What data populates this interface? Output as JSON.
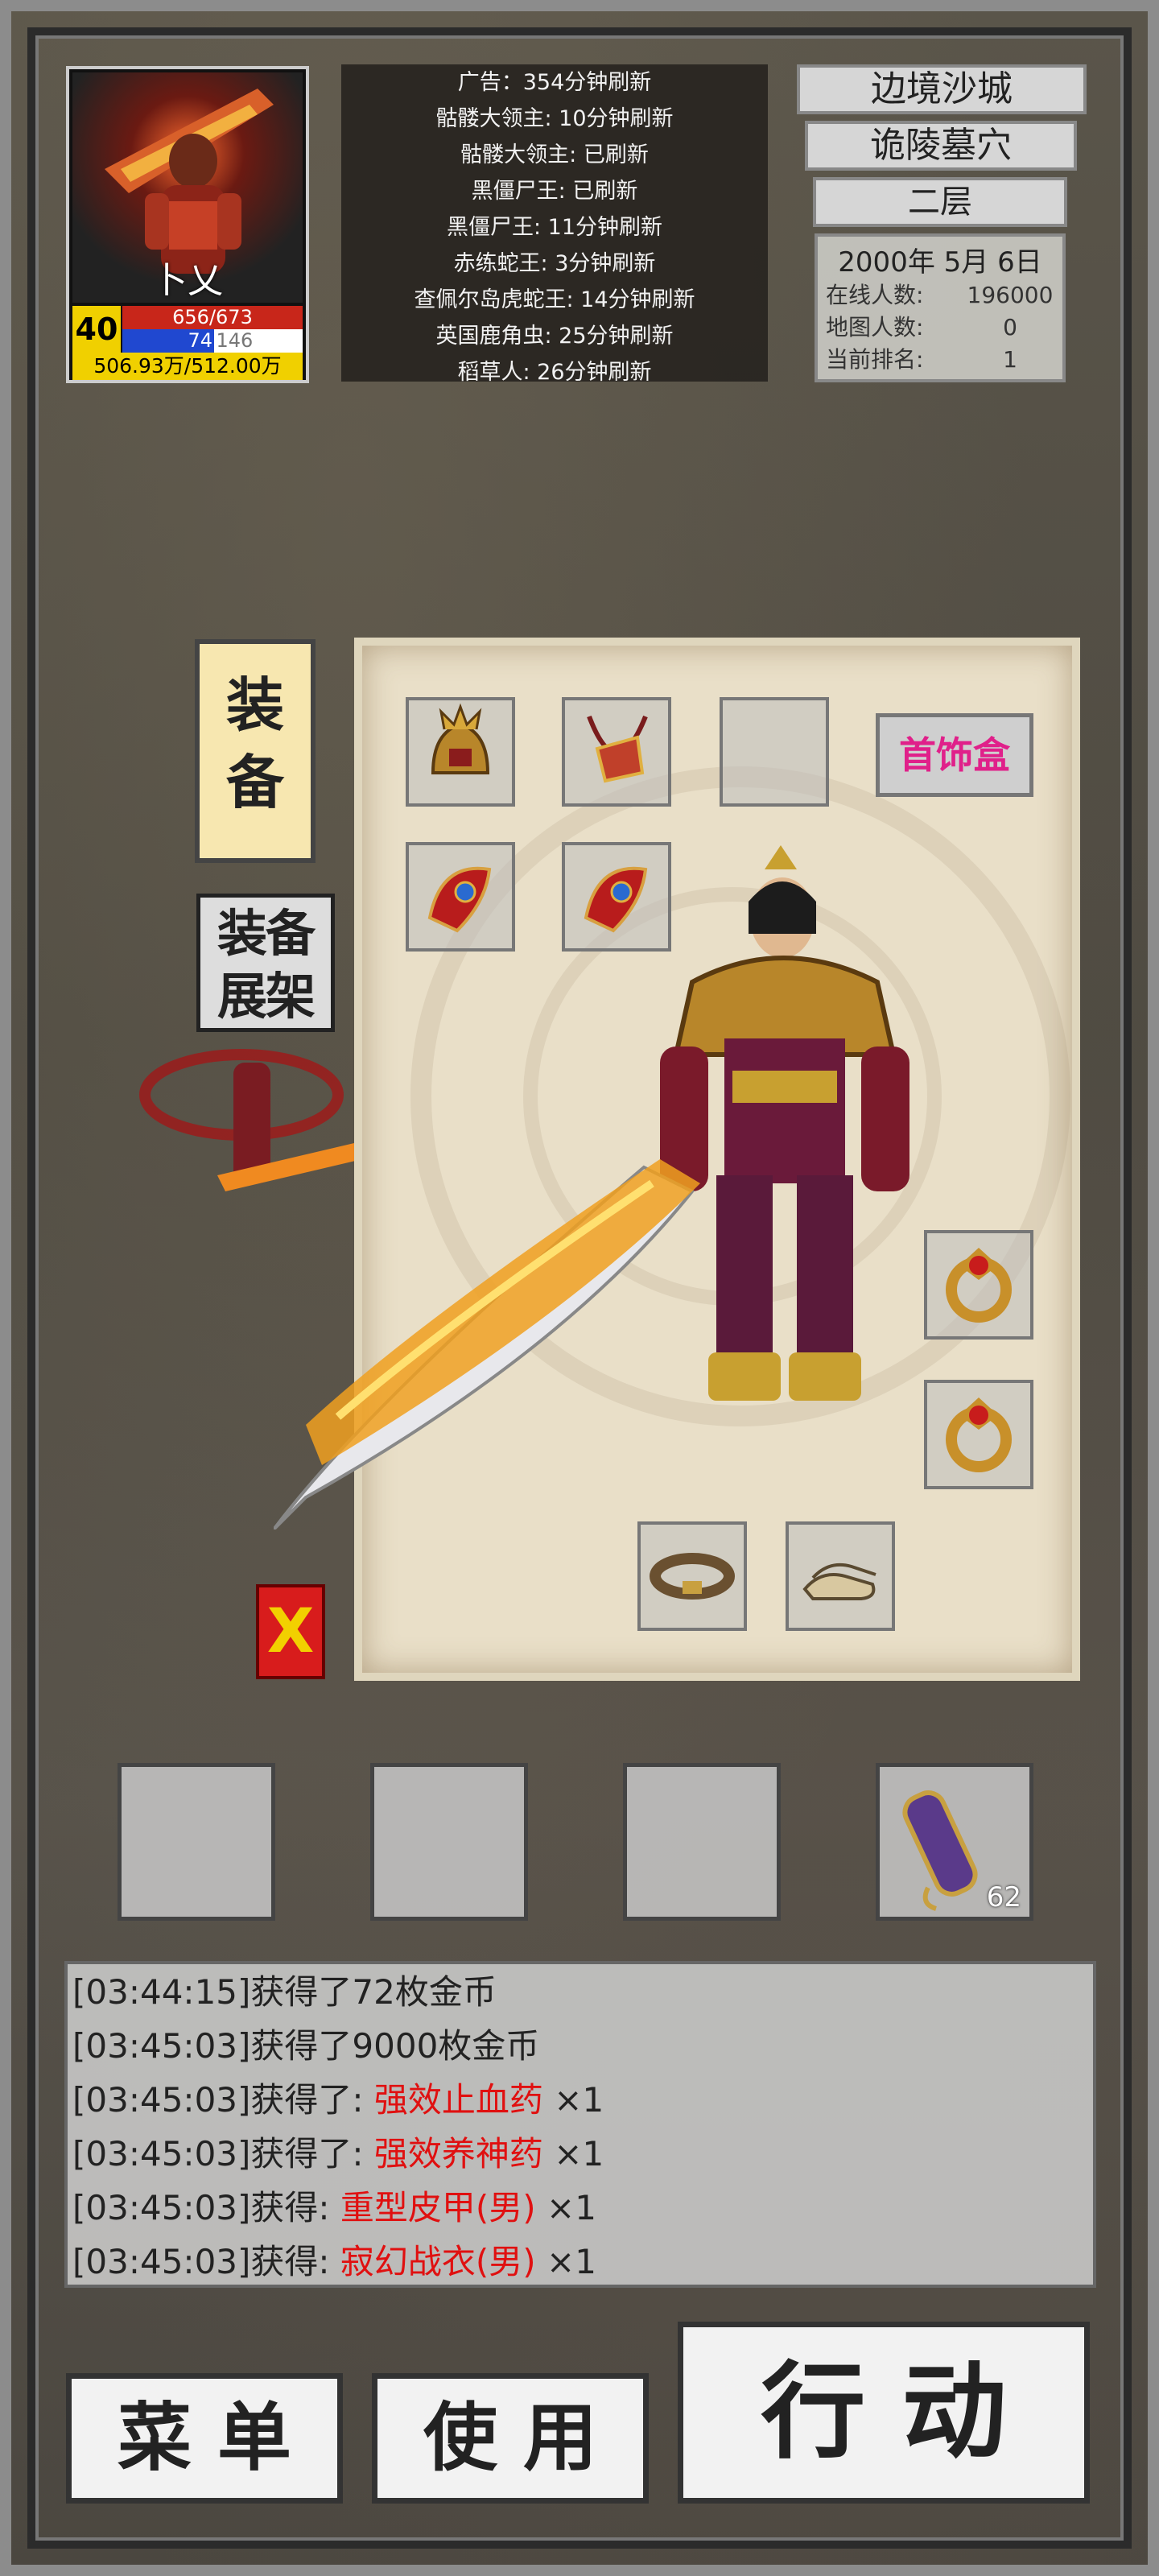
{
  "player": {
    "name": "卜乂",
    "level": "40",
    "hp": "656/673",
    "mp_current": "74",
    "mp_max": "146",
    "mp_ratio": 0.507,
    "exp": "506.93万/512.00万"
  },
  "boss_timers": [
    "广告：354分钟刷新",
    "骷髅大领主: 10分钟刷新",
    "骷髅大领主: 已刷新",
    "黑僵尸王: 已刷新",
    "黑僵尸王: 11分钟刷新",
    "赤练蛇王: 3分钟刷新",
    "查佩尔岛虎蛇王: 14分钟刷新",
    "英国鹿角虫: 25分钟刷新",
    "稻草人: 26分钟刷新"
  ],
  "location": {
    "city": "边境沙城",
    "map": "诡陵墓穴",
    "floor": "二层",
    "date": "2000年 5月 6日",
    "online_label": "在线人数:",
    "online_value": "196000",
    "map_players_label": "地图人数:",
    "map_players_value": "0",
    "rank_label": "当前排名:",
    "rank_value": "1"
  },
  "equipment": {
    "tab_label": "装\n备",
    "shelf_label": "装备\n展架",
    "jewelry_box_label": "首饰盒",
    "close_label": "X"
  },
  "quick_slots": {
    "scroll_count": "62"
  },
  "log": [
    {
      "prefix": "[03:44:15]获得了72枚金币",
      "item": "",
      "suffix": ""
    },
    {
      "prefix": "[03:45:03]获得了9000枚金币",
      "item": "",
      "suffix": ""
    },
    {
      "prefix": "[03:45:03]获得了: ",
      "item": "强效止血药",
      "suffix": " ×1"
    },
    {
      "prefix": "[03:45:03]获得了: ",
      "item": "强效养神药",
      "suffix": " ×1"
    },
    {
      "prefix": "[03:45:03]获得: ",
      "item": "重型皮甲(男)",
      "suffix": " ×1"
    },
    {
      "prefix": "[03:45:03]获得: ",
      "item": "寂幻战衣(男)",
      "suffix": " ×1"
    }
  ],
  "buttons": {
    "menu": "菜 单",
    "use": "使 用",
    "action": "行 动"
  },
  "colors": {
    "item_highlight": "#e01010",
    "level_badge": "#f0d000",
    "hp_bar": "#c8261a",
    "mp_bar": "#2048d0",
    "jewelry_text": "#e0208a"
  }
}
